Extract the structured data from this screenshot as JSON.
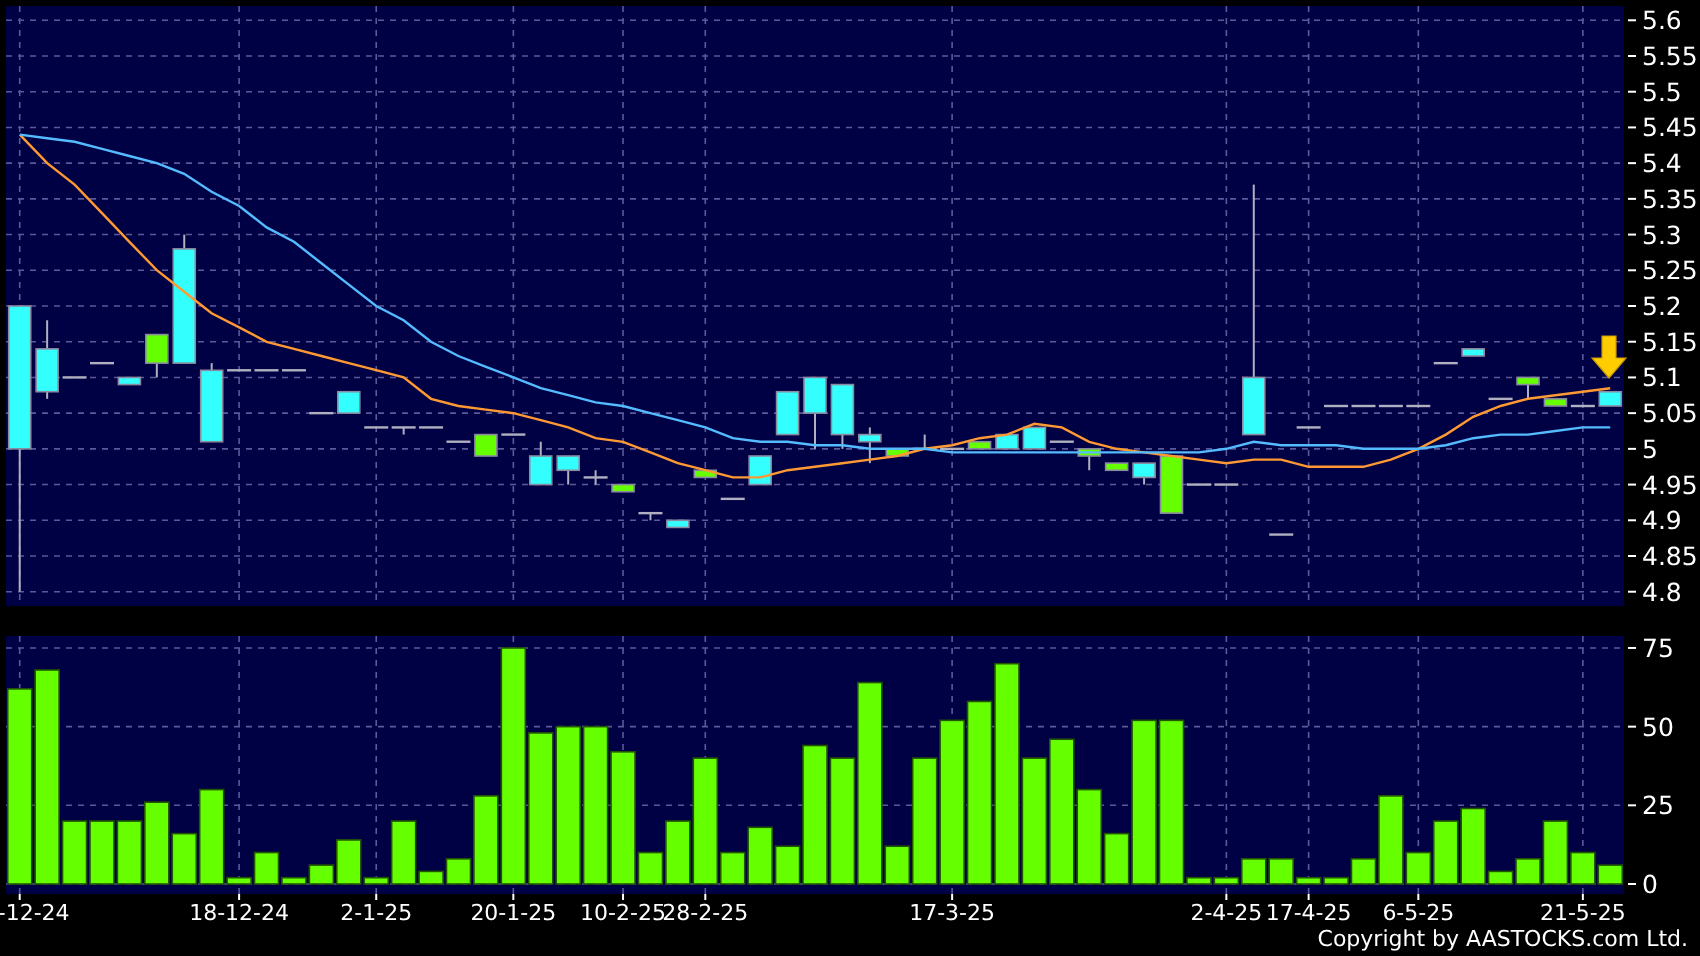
{
  "price_chart": {
    "chart_data": {
      "type": "candlestick",
      "grid": true,
      "ylim": [
        4.78,
        5.62
      ],
      "yticks": [
        4.8,
        4.85,
        4.9,
        4.95,
        5,
        5.05,
        5.1,
        5.15,
        5.2,
        5.25,
        5.3,
        5.35,
        5.4,
        5.45,
        5.5,
        5.55,
        5.6
      ],
      "categories": [
        null,
        null,
        null,
        null,
        null,
        null,
        null,
        null,
        null,
        null,
        null,
        null,
        null,
        null,
        null,
        null,
        null,
        null,
        null,
        null,
        null,
        null,
        null,
        null,
        null,
        null,
        null,
        null,
        null,
        null,
        null,
        null,
        null,
        null,
        null,
        null,
        null,
        null,
        null,
        null,
        null,
        null,
        null,
        null,
        null,
        null,
        null,
        null,
        null,
        null,
        null,
        null,
        null,
        null,
        null,
        null,
        null,
        null,
        null
      ],
      "ohlc": [
        [
          5.2,
          5.2,
          4.8,
          5.0
        ],
        [
          5.14,
          5.18,
          5.07,
          5.08
        ],
        [
          5.1,
          5.1,
          5.1,
          5.1
        ],
        [
          5.12,
          5.12,
          5.12,
          5.12
        ],
        [
          5.1,
          5.1,
          5.09,
          5.09
        ],
        [
          5.12,
          5.16,
          5.1,
          5.16
        ],
        [
          5.28,
          5.3,
          5.12,
          5.12
        ],
        [
          5.11,
          5.12,
          5.01,
          5.01
        ],
        [
          5.11,
          5.11,
          5.11,
          5.11
        ],
        [
          5.11,
          5.11,
          5.11,
          5.11
        ],
        [
          5.11,
          5.11,
          5.11,
          5.11
        ],
        [
          5.05,
          5.05,
          5.05,
          5.05
        ],
        [
          5.08,
          5.08,
          5.05,
          5.05
        ],
        [
          5.03,
          5.03,
          5.03,
          5.03
        ],
        [
          5.03,
          5.03,
          5.02,
          5.03
        ],
        [
          5.03,
          5.03,
          5.03,
          5.03
        ],
        [
          5.01,
          5.01,
          5.01,
          5.01
        ],
        [
          4.99,
          5.02,
          4.99,
          5.02
        ],
        [
          5.02,
          5.02,
          5.02,
          5.02
        ],
        [
          4.99,
          5.01,
          4.95,
          4.95
        ],
        [
          4.99,
          4.99,
          4.95,
          4.97
        ],
        [
          4.96,
          4.97,
          4.95,
          4.96
        ],
        [
          4.94,
          4.95,
          4.94,
          4.95
        ],
        [
          4.91,
          4.91,
          4.9,
          4.91
        ],
        [
          4.9,
          4.9,
          4.89,
          4.89
        ],
        [
          4.96,
          4.97,
          4.96,
          4.97
        ],
        [
          4.93,
          4.93,
          4.93,
          4.93
        ],
        [
          4.99,
          4.99,
          4.95,
          4.95
        ],
        [
          5.08,
          5.08,
          5.02,
          5.02
        ],
        [
          5.1,
          5.1,
          5.0,
          5.05
        ],
        [
          5.09,
          5.09,
          5.0,
          5.02
        ],
        [
          5.02,
          5.03,
          4.98,
          5.01
        ],
        [
          4.99,
          5.0,
          4.99,
          5.0
        ],
        [
          5.0,
          5.02,
          5.0,
          5.0
        ],
        [
          5.0,
          5.0,
          5.0,
          5.0
        ],
        [
          5.0,
          5.01,
          5.0,
          5.01
        ],
        [
          5.02,
          5.02,
          5.0,
          5.0
        ],
        [
          5.03,
          5.03,
          5.0,
          5.0
        ],
        [
          5.01,
          5.01,
          5.01,
          5.01
        ],
        [
          4.99,
          5.0,
          4.97,
          5.0
        ],
        [
          4.97,
          4.98,
          4.97,
          4.98
        ],
        [
          4.98,
          4.98,
          4.95,
          4.96
        ],
        [
          4.91,
          4.99,
          4.91,
          4.99
        ],
        [
          4.95,
          4.95,
          4.95,
          4.95
        ],
        [
          4.95,
          4.95,
          4.95,
          4.95
        ],
        [
          5.1,
          5.37,
          5.02,
          5.02
        ],
        [
          4.88,
          4.88,
          4.88,
          4.88
        ],
        [
          5.03,
          5.03,
          5.03,
          5.03
        ],
        [
          5.06,
          5.06,
          5.06,
          5.06
        ],
        [
          5.06,
          5.06,
          5.06,
          5.06
        ],
        [
          5.06,
          5.06,
          5.06,
          5.06
        ],
        [
          5.06,
          5.06,
          5.06,
          5.06
        ],
        [
          5.12,
          5.12,
          5.12,
          5.12
        ],
        [
          5.14,
          5.14,
          5.13,
          5.13
        ],
        [
          5.07,
          5.07,
          5.07,
          5.07
        ],
        [
          5.09,
          5.1,
          5.07,
          5.1
        ],
        [
          5.06,
          5.07,
          5.06,
          5.07
        ],
        [
          5.06,
          5.06,
          5.06,
          5.06
        ],
        [
          5.08,
          5.08,
          5.06,
          5.06
        ]
      ],
      "series": [
        {
          "type": "line",
          "color": "#ff9933",
          "values": [
            5.44,
            5.4,
            5.37,
            5.33,
            5.29,
            5.25,
            5.22,
            5.19,
            5.17,
            5.15,
            5.14,
            5.13,
            5.12,
            5.11,
            5.1,
            5.07,
            5.06,
            5.055,
            5.05,
            5.04,
            5.03,
            5.015,
            5.01,
            4.995,
            4.98,
            4.97,
            4.96,
            4.96,
            4.97,
            4.975,
            4.98,
            4.985,
            4.99,
            5.0,
            5.005,
            5.015,
            5.02,
            5.035,
            5.03,
            5.01,
            5.0,
            4.995,
            4.99,
            4.985,
            4.98,
            4.985,
            4.985,
            4.975,
            4.975,
            4.975,
            4.985,
            5.0,
            5.02,
            5.045,
            5.06,
            5.07,
            5.075,
            5.08,
            5.085
          ]
        },
        {
          "type": "line",
          "color": "#55bbff",
          "values": [
            5.44,
            5.435,
            5.43,
            5.42,
            5.41,
            5.4,
            5.385,
            5.36,
            5.34,
            5.31,
            5.29,
            5.26,
            5.23,
            5.2,
            5.18,
            5.15,
            5.13,
            5.115,
            5.1,
            5.085,
            5.075,
            5.065,
            5.06,
            5.05,
            5.04,
            5.03,
            5.015,
            5.01,
            5.01,
            5.005,
            5.005,
            5.0,
            5.0,
            5.0,
            4.995,
            4.995,
            4.995,
            4.995,
            4.995,
            4.995,
            4.995,
            4.995,
            4.995,
            4.995,
            5.0,
            5.01,
            5.005,
            5.005,
            5.005,
            5.0,
            5.0,
            5.0,
            5.005,
            5.015,
            5.02,
            5.02,
            5.025,
            5.03,
            5.03
          ]
        }
      ]
    }
  },
  "volume_chart": {
    "chart_data": {
      "type": "bar",
      "grid": true,
      "ylim": [
        0,
        78.8
      ],
      "yticks": [
        0,
        25,
        50,
        75
      ],
      "categories": [
        "-12-24",
        null,
        null,
        null,
        null,
        null,
        null,
        null,
        "18-12-24",
        null,
        null,
        null,
        null,
        "2-1-25",
        null,
        null,
        null,
        null,
        "20-1-25",
        null,
        null,
        null,
        "10-2-25",
        null,
        null,
        "28-2-25",
        null,
        null,
        null,
        null,
        null,
        null,
        null,
        null,
        "17-3-25",
        null,
        null,
        null,
        null,
        null,
        null,
        null,
        null,
        null,
        "2-4-25",
        null,
        null,
        "17-4-25",
        null,
        null,
        null,
        "6-5-25",
        null,
        null,
        null,
        null,
        null,
        "21-5-25",
        null
      ],
      "values": [
        62,
        68,
        20,
        20,
        20,
        26,
        16,
        30,
        2,
        10,
        2,
        6,
        14,
        2,
        20,
        4,
        8,
        28,
        75,
        48,
        50,
        50,
        42,
        10,
        20,
        40,
        10,
        18,
        12,
        44,
        40,
        64,
        12,
        40,
        52,
        58,
        70,
        40,
        46,
        30,
        16,
        52,
        52,
        2,
        2,
        8,
        8,
        2,
        2,
        8,
        28,
        10,
        20,
        24,
        4,
        8,
        20,
        10,
        6
      ]
    }
  },
  "copyright": "Copyright by AASTOCKS.com Ltd."
}
